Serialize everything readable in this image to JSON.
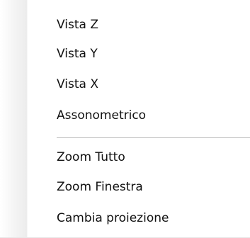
{
  "menu": {
    "groups": [
      {
        "items": [
          {
            "label": "Vista Z"
          },
          {
            "label": "Vista Y"
          },
          {
            "label": "Vista X"
          },
          {
            "label": "Assonometrico"
          }
        ]
      },
      {
        "items": [
          {
            "label": "Zoom Tutto"
          },
          {
            "label": "Zoom Finestra"
          },
          {
            "label": "Cambia proiezione"
          }
        ]
      }
    ]
  }
}
